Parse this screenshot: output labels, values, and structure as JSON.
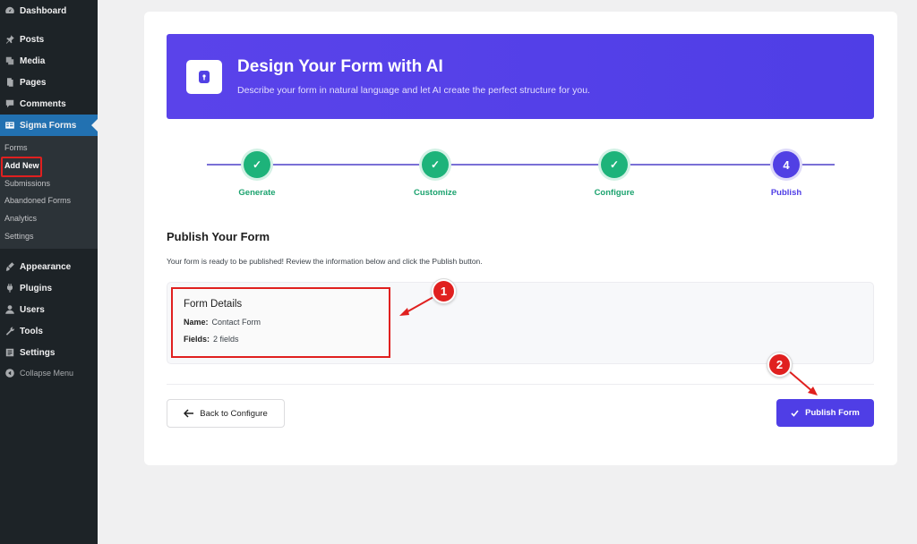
{
  "sidebar": {
    "items": [
      {
        "label": "Dashboard",
        "icon": "dashboard-icon"
      },
      {
        "label": "Posts",
        "icon": "pin-icon"
      },
      {
        "label": "Media",
        "icon": "media-icon"
      },
      {
        "label": "Pages",
        "icon": "pages-icon"
      },
      {
        "label": "Comments",
        "icon": "comment-icon"
      },
      {
        "label": "Sigma Forms",
        "icon": "form-icon"
      },
      {
        "label": "Appearance",
        "icon": "brush-icon"
      },
      {
        "label": "Plugins",
        "icon": "plugin-icon"
      },
      {
        "label": "Users",
        "icon": "users-icon"
      },
      {
        "label": "Tools",
        "icon": "wrench-icon"
      },
      {
        "label": "Settings",
        "icon": "settings-icon"
      },
      {
        "label": "Collapse Menu",
        "icon": "collapse-icon"
      }
    ],
    "submenu": [
      "Forms",
      "Add New",
      "Submissions",
      "Abandoned Forms",
      "Analytics",
      "Settings"
    ],
    "active_color": "#2271b1"
  },
  "hero": {
    "title": "Design Your Form with AI",
    "subtitle": "Describe your form in natural language and let AI create the perfect structure for you.",
    "icon": "ai-lock-icon",
    "color": "#5140e4"
  },
  "steps": [
    {
      "label": "Generate",
      "state": "done"
    },
    {
      "label": "Customize",
      "state": "done"
    },
    {
      "label": "Configure",
      "state": "done"
    },
    {
      "label": "Publish",
      "state": "current",
      "number": "4"
    }
  ],
  "publish": {
    "title": "Publish Your Form",
    "description": "Your form is ready to be published! Review the information below and click the Publish button.",
    "details_title": "Form Details",
    "name_label": "Name:",
    "name_value": "Contact Form",
    "fields_label": "Fields:",
    "fields_value": "2 fields"
  },
  "buttons": {
    "back": "Back to Configure",
    "publish": "Publish Form"
  },
  "annotations": [
    "1",
    "2"
  ]
}
